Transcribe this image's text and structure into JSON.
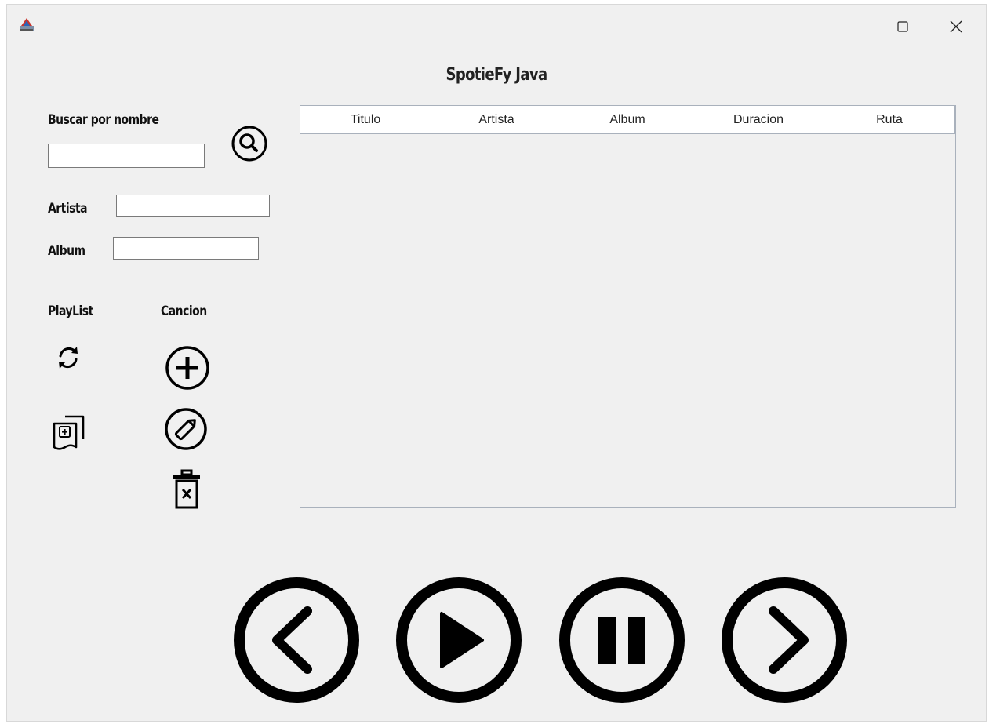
{
  "window": {
    "controls": [
      "minimize-icon",
      "maximize-icon",
      "close-icon"
    ]
  },
  "app": {
    "title": "SpotieFy Java"
  },
  "search": {
    "label": "Buscar por nombre",
    "value": "",
    "icon": "search-icon"
  },
  "filters": {
    "artist_label": "Artista",
    "artist_value": "",
    "album_label": "Album",
    "album_value": ""
  },
  "playlist": {
    "label": "PlayList",
    "icons": [
      "refresh-icon",
      "add-playlist-icon"
    ]
  },
  "song": {
    "label": "Cancion",
    "icons": [
      "add-icon",
      "edit-icon",
      "delete-icon"
    ]
  },
  "table": {
    "columns": [
      "Titulo",
      "Artista",
      "Album",
      "Duracion",
      "Ruta"
    ],
    "rows": []
  },
  "player": {
    "icons": [
      "previous-icon",
      "play-icon",
      "pause-icon",
      "next-icon"
    ]
  },
  "colors": {
    "window_bg": "#f0f0f0",
    "icon": "#000000",
    "border": "#a9b1bc"
  }
}
